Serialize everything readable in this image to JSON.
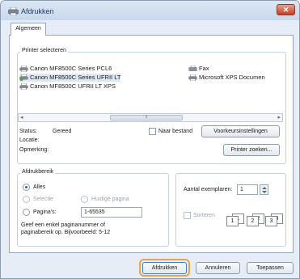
{
  "window": {
    "title": "Afdrukken",
    "close_label": "✕"
  },
  "tab": {
    "label": "Algemeen"
  },
  "printer_select": {
    "legend": "Printer selecteren",
    "printers": [
      {
        "name": "Canon MF8500C Series PCL6",
        "selected": false
      },
      {
        "name": "Canon MF8500C Series UFRII LT",
        "selected": true
      },
      {
        "name": "Canon MF8500C UFRII LT XPS",
        "selected": false
      },
      {
        "name": "Fax",
        "selected": false
      },
      {
        "name": "Microsoft XPS Documen",
        "selected": false
      }
    ],
    "scroll_left": "◂",
    "scroll_right": "▸",
    "scroll_thumb_grip": "⦀"
  },
  "status": {
    "status_label": "Status:",
    "status_value": "Gereed",
    "location_label": "Locatie:",
    "comment_label": "Opmerking:",
    "print_to_file_label": "Naar bestand",
    "preferences_button": "Voorkeursinstellingen",
    "find_printer_button": "Printer zoeken..."
  },
  "range": {
    "legend": "Afdrukbereik",
    "all": "Alles",
    "selection": "Selectie",
    "current_page": "Huidige pagina",
    "pages": "Pagina's:",
    "pages_value": "1-65535",
    "hint_line1": "Geef een enkel paginanummer of",
    "hint_line2": "paginabereik op. Bijvoorbeeld: 5-12"
  },
  "copies": {
    "label": "Aantal exemplaren:",
    "value": "1",
    "collate_label": "Sorteren",
    "collate_pages": [
      "1",
      "1",
      "2",
      "2",
      "3",
      "3"
    ]
  },
  "footer": {
    "print_button": "Afdrukken",
    "cancel_button": "Annuleren",
    "apply_button": "Toepassen"
  }
}
